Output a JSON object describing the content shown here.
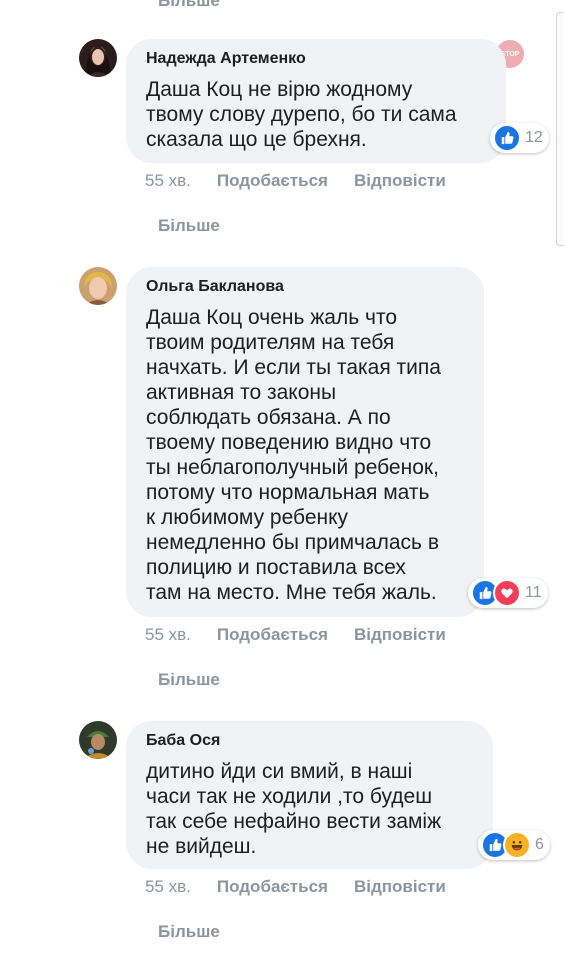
{
  "top_more_label": "Більше",
  "comments": [
    {
      "author": "Надежда Артеменко",
      "text": "Даша Коц не вірю жодному\nтвому слову дурепо, бо ти сама\nсказала що це брехня.",
      "reaction_count": "12",
      "reactions": [
        "like"
      ],
      "time": "55 хв.",
      "like_label": "Подобається",
      "reply_label": "Відповісти",
      "more_label": "Більше"
    },
    {
      "author": "Ольга Бакланова",
      "text": "Даша Коц очень жаль что\nтвоим родителям на тебя\nначхать. И если ты такая типа\nактивная то законы\nсоблюдать обязана. А по\nтвоему поведению видно что\nты неблагополучный ребенок,\nпотому что нормальная мать\nк любимому ребенку\nнемедленно бы примчалась в\nполицию и поставила всех\nтам на место. Мне тебя жаль.",
      "reaction_count": "11",
      "reactions": [
        "like",
        "love"
      ],
      "time": "55 хв.",
      "like_label": "Подобається",
      "reply_label": "Відповісти",
      "more_label": "Більше"
    },
    {
      "author": "Баба Ося",
      "text": "дитино йди си вмий, в наші\nчаси так не ходили ,то будеш\nтак себе нефайно вести заміж\nне вийдеш.",
      "reaction_count": "6",
      "reactions": [
        "like",
        "haha"
      ],
      "time": "55 хв.",
      "like_label": "Подобається",
      "reply_label": "Відповісти",
      "more_label": "Більше"
    }
  ],
  "colors": {
    "bubble": "#f0f2f5",
    "meta": "#8d949e",
    "like": "#1b74e4",
    "love": "#f33e58",
    "haha": "#f7b125"
  }
}
